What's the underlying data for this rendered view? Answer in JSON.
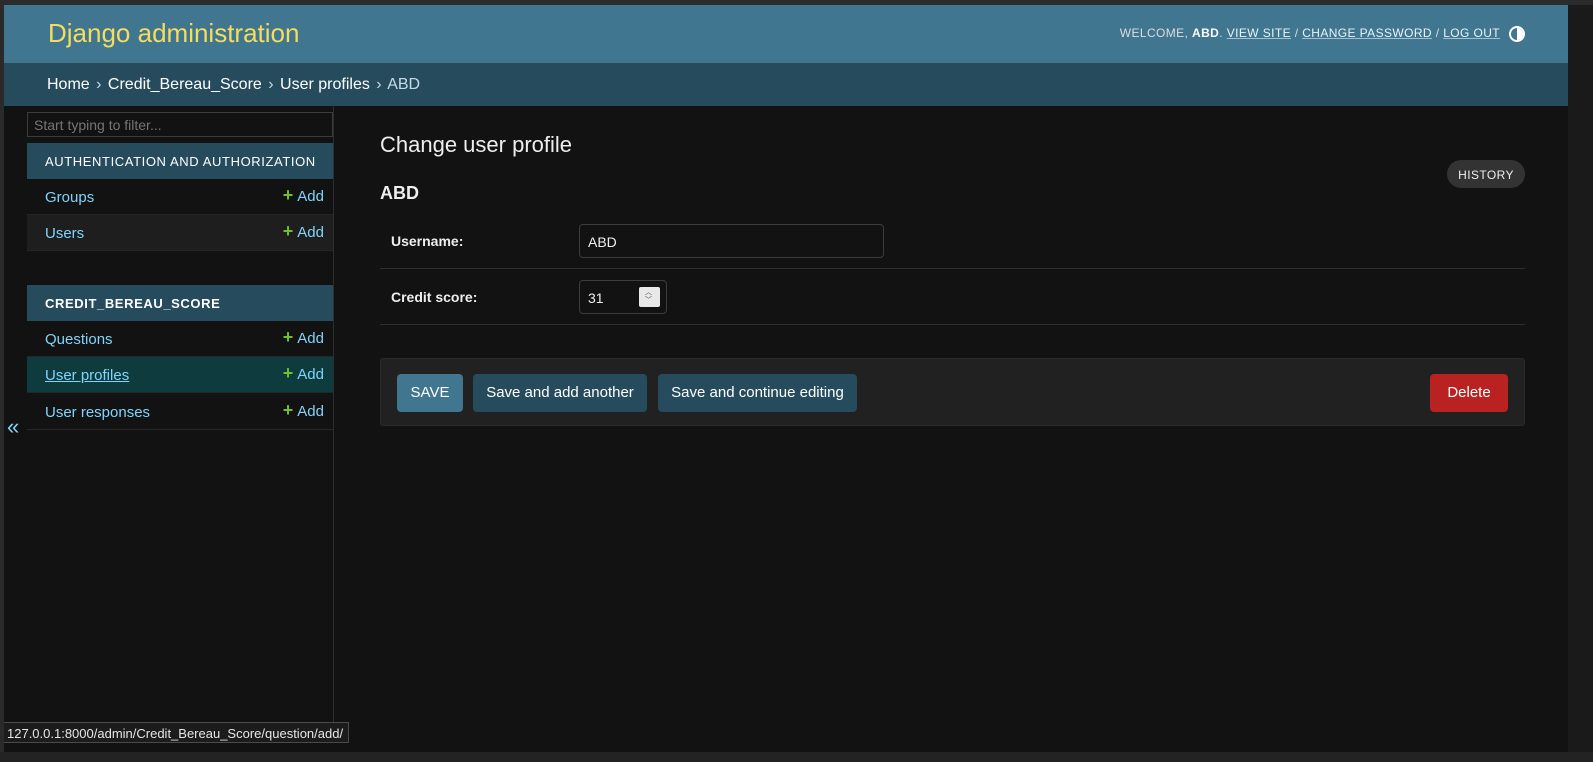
{
  "header": {
    "brand": "Django administration",
    "welcome": "WELCOME,",
    "username": "ABD",
    "view_site": "VIEW SITE",
    "change_password": "CHANGE PASSWORD",
    "log_out": "LOG OUT",
    "separator": "/",
    "theme_icon": "half-circle-contrast-icon"
  },
  "breadcrumbs": {
    "home": "Home",
    "app": "Credit_Bereau_Score",
    "model": "User profiles",
    "current": "ABD",
    "separator": "›"
  },
  "sidebar": {
    "filter_placeholder": "Start typing to filter...",
    "collapse_icon": "«",
    "modules": [
      {
        "caption": "Authentication and Authorization",
        "models": [
          {
            "name": "Groups",
            "add": "Add"
          },
          {
            "name": "Users",
            "add": "Add"
          }
        ]
      },
      {
        "caption": "CREDIT_BEREAU_SCORE",
        "models": [
          {
            "name": "Questions",
            "add": "Add"
          },
          {
            "name": "User profiles",
            "add": "Add",
            "current": true
          },
          {
            "name": "User responses",
            "add": "Add"
          }
        ]
      }
    ]
  },
  "content": {
    "title": "Change user profile",
    "history": "HISTORY",
    "object_name": "ABD",
    "fields": {
      "username_label": "Username:",
      "username_value": "ABD",
      "credit_score_label": "Credit score:",
      "credit_score_value": "31"
    },
    "buttons": {
      "save": "SAVE",
      "save_add_another": "Save and add another",
      "save_continue": "Save and continue editing",
      "delete": "Delete"
    }
  },
  "status_bar": {
    "url": "127.0.0.1:8000/admin/Credit_Bereau_Score/question/add/"
  },
  "colors": {
    "header_bg": "#417690",
    "brand": "#f5dd5d",
    "breadcrumb_bg": "#264b5d",
    "link": "#81d4fa",
    "add_plus": "#70bf2b",
    "delete": "#ba2121",
    "background": "#121212"
  }
}
